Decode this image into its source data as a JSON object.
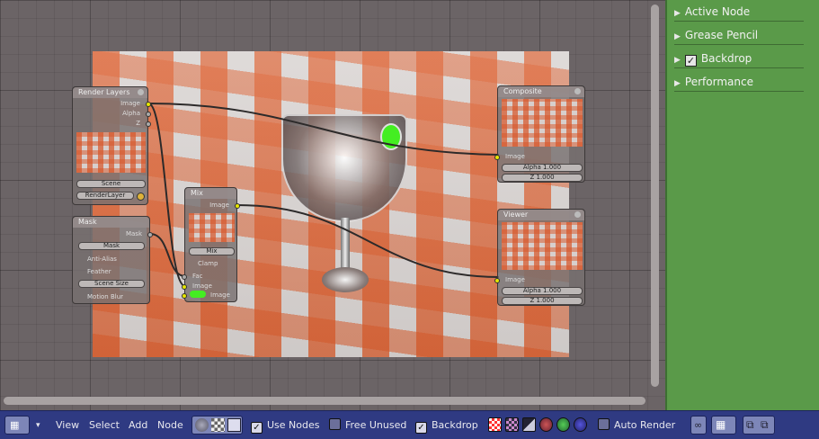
{
  "panel": {
    "items": [
      {
        "label": "Active Node",
        "checked": null
      },
      {
        "label": "Grease Pencil",
        "checked": null
      },
      {
        "label": "Backdrop",
        "checked": true
      },
      {
        "label": "Performance",
        "checked": null
      }
    ]
  },
  "nodes": {
    "render_layers": {
      "title": "Render Layers",
      "out_image": "Image",
      "out_alpha": "Alpha",
      "out_z": "Z",
      "scene": "Scene",
      "layer": "RenderLayer"
    },
    "mask": {
      "title": "Mask",
      "out_mask": "Mask",
      "mask_name": "Mask",
      "anti_alias": "Anti-Alias",
      "feather": "Feather",
      "size_mode": "Scene Size",
      "motion_blur": "Motion Blur"
    },
    "mix": {
      "title": "Mix",
      "out_image": "Image",
      "blend": "Mix",
      "clamp": "Clamp",
      "in_fac": "Fac",
      "in_image1": "Image",
      "in_image2": "Image"
    },
    "composite": {
      "title": "Composite",
      "in_image": "Image",
      "alpha": "Alpha 1.000",
      "z": "Z 1.000"
    },
    "viewer": {
      "title": "Viewer",
      "in_image": "Image",
      "alpha": "Alpha 1.000",
      "z": "Z 1.000"
    }
  },
  "header": {
    "menus": [
      "View",
      "Select",
      "Add",
      "Node"
    ],
    "use_nodes": {
      "label": "Use Nodes",
      "checked": true
    },
    "free_unused": {
      "label": "Free Unused",
      "checked": false
    },
    "backdrop": {
      "label": "Backdrop",
      "checked": true
    },
    "auto_render": {
      "label": "Auto Render",
      "checked": false
    }
  },
  "colors": {
    "panel_bg": "#5a9a49",
    "header_bg": "#2f3a82",
    "socket_yellow": "#e6e600",
    "accent_green": "#44ee22"
  }
}
